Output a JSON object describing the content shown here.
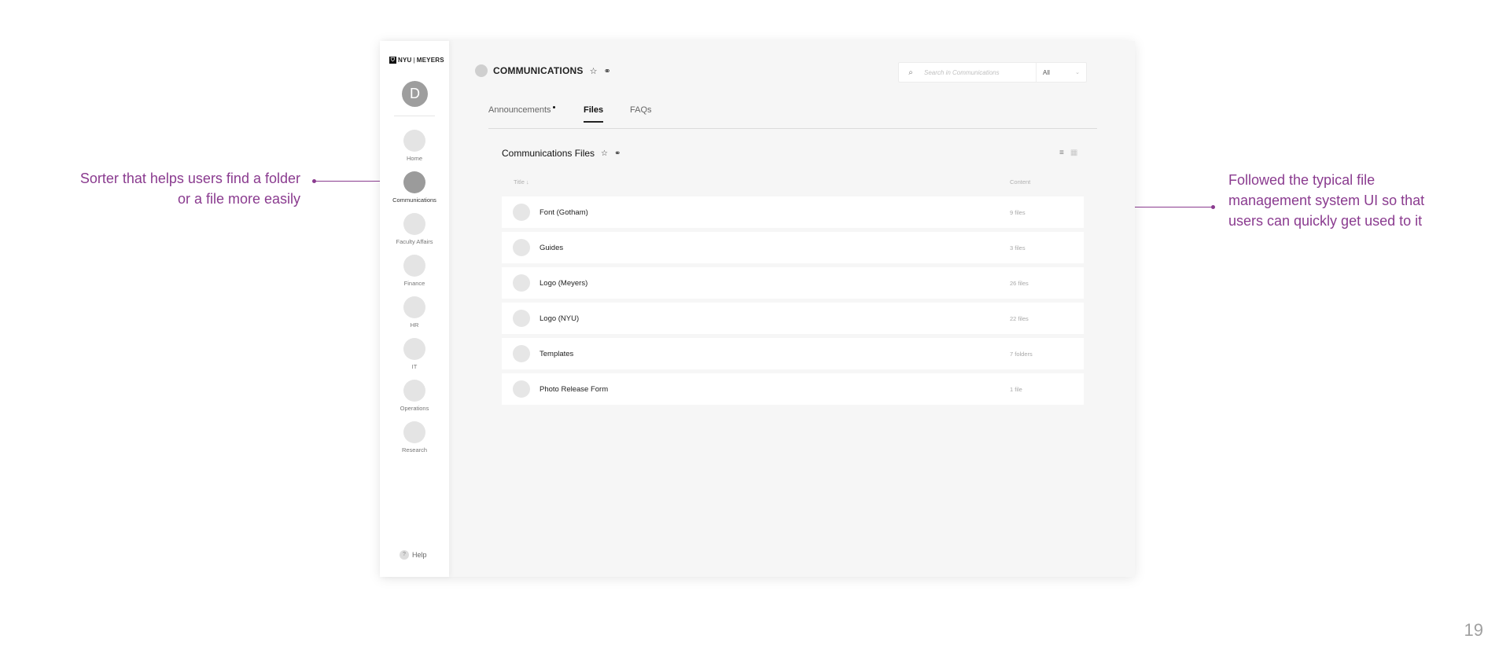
{
  "app": {
    "logo": {
      "mark": "⛉",
      "left": "NYU",
      "separator": "|",
      "right": "MEYERS"
    },
    "user_initial": "D",
    "help_label": "Help",
    "help_glyph": "?"
  },
  "sidebar": {
    "items": [
      {
        "label": "Home",
        "active": false
      },
      {
        "label": "Communications",
        "active": true
      },
      {
        "label": "Faculty Affairs",
        "active": false
      },
      {
        "label": "Finance",
        "active": false
      },
      {
        "label": "HR",
        "active": false
      },
      {
        "label": "IT",
        "active": false
      },
      {
        "label": "Operations",
        "active": false
      },
      {
        "label": "Research",
        "active": false
      }
    ]
  },
  "header": {
    "title": "COMMUNICATIONS",
    "star_glyph": "☆",
    "link_glyph": "⚭",
    "search_placeholder": "Search in Communications",
    "search_glyph": "⌕",
    "scope_value": "All",
    "scope_chevron": "⌄"
  },
  "tabs": [
    {
      "label": "Announcements",
      "active": false,
      "has_notification": true
    },
    {
      "label": "Files",
      "active": true,
      "has_notification": false
    },
    {
      "label": "FAQs",
      "active": false,
      "has_notification": false
    }
  ],
  "files": {
    "section_title": "Communications Files",
    "columns": {
      "title": "Title ↓",
      "content": "Content"
    },
    "list_view_glyph": "≡",
    "grid_view_glyph": "▦",
    "rows": [
      {
        "name": "Font (Gotham)",
        "content": "9 files"
      },
      {
        "name": "Guides",
        "content": "3 files"
      },
      {
        "name": "Logo (Meyers)",
        "content": "26 files"
      },
      {
        "name": "Logo (NYU)",
        "content": "22 files"
      },
      {
        "name": "Templates",
        "content": "7 folders"
      },
      {
        "name": "Photo Release Form",
        "content": "1 file"
      }
    ]
  },
  "annotations": {
    "left": "Sorter that helps users find a folder or a file more easily",
    "right": "Followed the typical file management system UI so that users can quickly get used to it",
    "accent_color": "#8a3b8f"
  },
  "page_number": "19"
}
